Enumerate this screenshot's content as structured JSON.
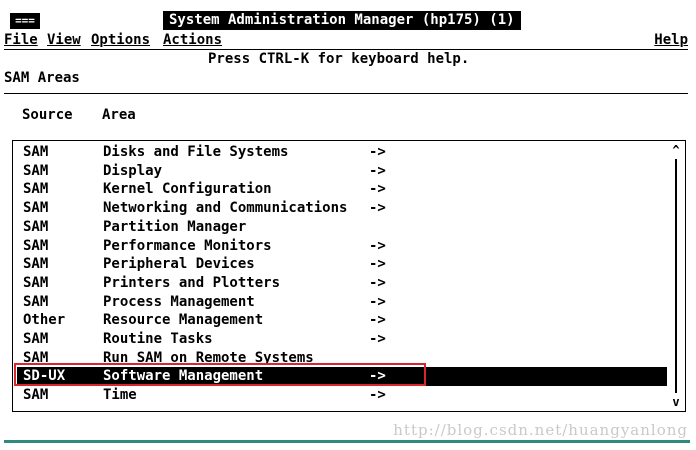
{
  "window": {
    "menu_button": "===",
    "title": "System Administration Manager (hp175) (1)"
  },
  "menubar": {
    "file": "File",
    "view": "View",
    "options": "Options",
    "actions": "Actions",
    "help": "Help"
  },
  "hint": "Press CTRL-K for keyboard help.",
  "section_title": "SAM Areas",
  "columns": {
    "source": "Source",
    "area": "Area"
  },
  "rows": [
    {
      "source": "SAM",
      "area": "Disks and File Systems",
      "arrow": "->"
    },
    {
      "source": "SAM",
      "area": "Display",
      "arrow": "->"
    },
    {
      "source": "SAM",
      "area": "Kernel Configuration",
      "arrow": "->"
    },
    {
      "source": "SAM",
      "area": "Networking and Communications",
      "arrow": "->"
    },
    {
      "source": "SAM",
      "area": "Partition Manager",
      "arrow": ""
    },
    {
      "source": "SAM",
      "area": "Performance Monitors",
      "arrow": "->"
    },
    {
      "source": "SAM",
      "area": "Peripheral Devices",
      "arrow": "->"
    },
    {
      "source": "SAM",
      "area": "Printers and Plotters",
      "arrow": "->"
    },
    {
      "source": "SAM",
      "area": "Process Management",
      "arrow": "->"
    },
    {
      "source": "Other",
      "area": "Resource Management",
      "arrow": "->"
    },
    {
      "source": "SAM",
      "area": "Routine Tasks",
      "arrow": "->"
    },
    {
      "source": "SAM",
      "area": "Run SAM on Remote Systems",
      "arrow": ""
    },
    {
      "source": "SD-UX",
      "area": "Software Management",
      "arrow": "->",
      "selected": true
    },
    {
      "source": "SAM",
      "area": "Time",
      "arrow": "->"
    }
  ],
  "scrollbar": {
    "up": "^",
    "down": "v"
  },
  "watermark": "http://blog.csdn.net/huangyanlong",
  "colors": {
    "highlight_border": "#d7262e",
    "bottom_rule": "#2f8a7c"
  }
}
